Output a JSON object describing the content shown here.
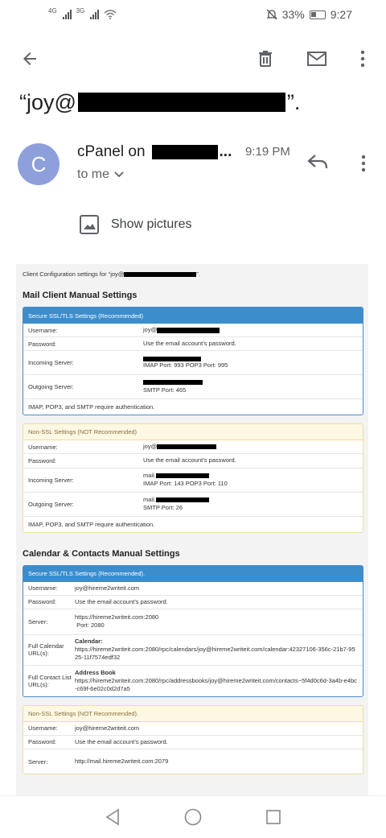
{
  "status_bar": {
    "sig1_tag": "4G",
    "sig2_tag": "3G",
    "battery": "33%",
    "time": "9:27"
  },
  "subject": {
    "prefix": "“joy@",
    "suffix": "”."
  },
  "sender": {
    "avatar_letter": "C",
    "name": "cPanel on",
    "ellipsis": "...",
    "time": "9:19 PM",
    "recipient": "to me"
  },
  "show_pictures": "Show pictures",
  "email": {
    "intro": "Client Configuration settings for “joy@",
    "intro_end": "”.",
    "mail_title": "Mail Client Manual Settings",
    "secure": {
      "header": "Secure SSL/TLS Settings (Recommended)",
      "username_label": "Username:",
      "username_value": "joy@",
      "password_label": "Password:",
      "password_value": "Use the email account’s password.",
      "incoming_label": "Incoming Server:",
      "incoming_ports": "IMAP Port: 993  POP3 Port: 995",
      "outgoing_label": "Outgoing Server:",
      "outgoing_ports": "SMTP Port: 465",
      "note": "IMAP, POP3, and SMTP require authentication."
    },
    "nonssl": {
      "header": "Non-SSL Settings (NOT Recommended)",
      "username_label": "Username:",
      "username_value": "joy@",
      "password_label": "Password:",
      "password_value": "Use the email account’s password.",
      "incoming_label": "Incoming Server:",
      "incoming_host": "mail.",
      "incoming_ports": "IMAP Port: 143  POP3 Port: 110",
      "outgoing_label": "Outgoing Server:",
      "outgoing_host": "mail.",
      "outgoing_ports": "SMTP Port: 26",
      "note": "IMAP, POP3, and SMTP require authentication."
    },
    "cal_title": "Calendar & Contacts Manual Settings",
    "cal_secure": {
      "header": "Secure SSL/TLS Settings (Recommended).",
      "username_label": "Username:",
      "username_value": "joy@hireme2writeit.com",
      "password_label": "Password:",
      "password_value": "Use the email account’s password.",
      "server_label": "Server:",
      "server_value": "https://hireme2writeit.com:2080",
      "server_port": "Port: 2080",
      "calendar_label": "Full Calendar URL(s):",
      "calendar_title": "Calendar:",
      "calendar_url": "https://hireme2writeit.com:2080/rpc/calendars/joy@hireme2writeit.com/calendar:42327106-356c-21b7-9525-11f7574edf32",
      "contacts_label": "Full Contact List URL(s):",
      "contacts_title": "Address Book",
      "contacts_url": "https://hireme2writeit.com:2080/rpc/addressbooks/joy@hireme2writeit.com/contacts~5f4d0c6d-3a4b-e4bc-c69f-6e02c0d2d7a5"
    },
    "cal_nonssl": {
      "header": "Non-SSL Settings (NOT Recommended).",
      "username_label": "Username:",
      "username_value": "joy@hireme2writeit.com",
      "password_label": "Password:",
      "password_value": "Use the email account’s password.",
      "server_label": "Server:",
      "server_value": "http://mail.hireme2writeit.com:2079"
    }
  }
}
